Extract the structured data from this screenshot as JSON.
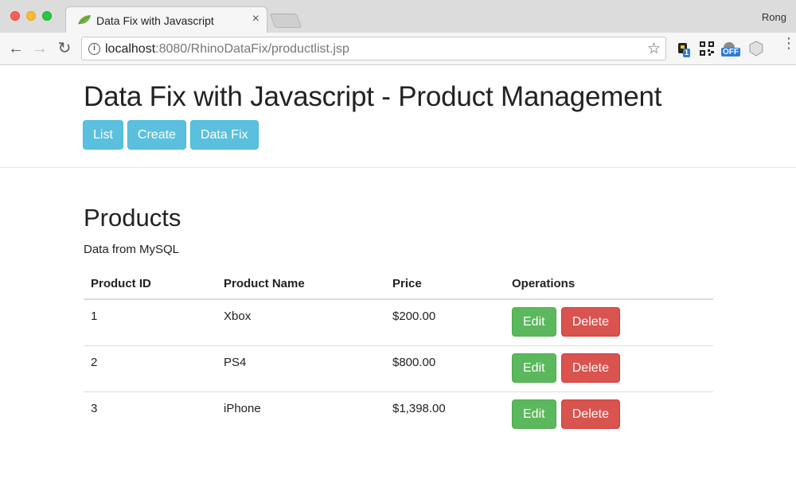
{
  "browser": {
    "tab_title": "Data Fix with Javascript",
    "tab_close": "×",
    "profile_name": "Rong",
    "url_host": "localhost",
    "url_rest": ":8080/RhinoDataFix/productlist.jsp",
    "back": "←",
    "forward": "→",
    "reload": "↻",
    "bookmark_star": "☆",
    "ext_badge_1": "1",
    "ext_badge_off": "OFF",
    "menu_dots": "⋮"
  },
  "header": {
    "title": "Data Fix with Javascript - Product Management",
    "buttons": {
      "list": "List",
      "create": "Create",
      "data_fix": "Data Fix"
    }
  },
  "products": {
    "heading": "Products",
    "subtitle": "Data from MySQL",
    "columns": {
      "id": "Product ID",
      "name": "Product Name",
      "price": "Price",
      "operations": "Operations"
    },
    "rows": [
      {
        "id": "1",
        "name": "Xbox",
        "price": "$200.00",
        "edit": "Edit",
        "delete": "Delete"
      },
      {
        "id": "2",
        "name": "PS4",
        "price": "$800.00",
        "edit": "Edit",
        "delete": "Delete"
      },
      {
        "id": "3",
        "name": "iPhone",
        "price": "$1,398.00",
        "edit": "Edit",
        "delete": "Delete"
      }
    ]
  },
  "colors": {
    "info": "#5bc0de",
    "success": "#5cb85c",
    "danger": "#d9534f"
  }
}
